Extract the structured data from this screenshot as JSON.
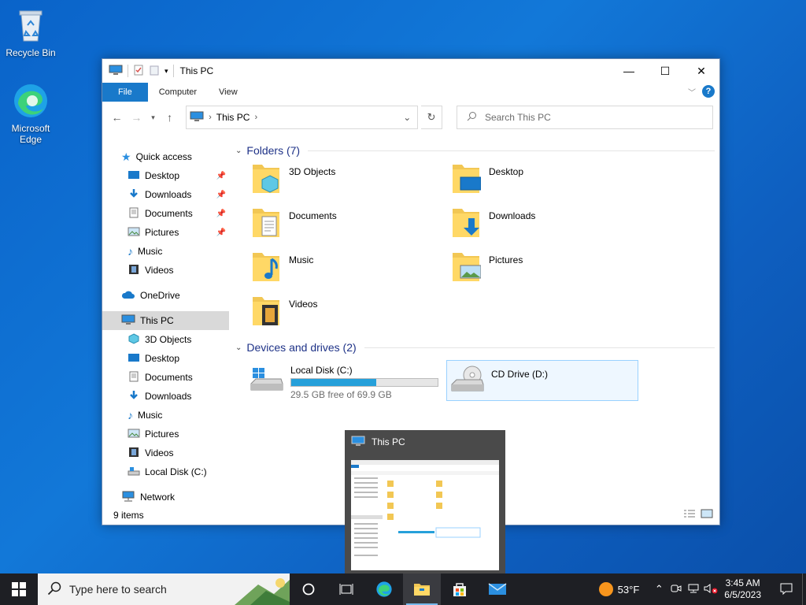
{
  "desktop": {
    "icons": [
      {
        "label": "Recycle Bin"
      },
      {
        "label": "Microsoft Edge"
      }
    ]
  },
  "window": {
    "title": "This PC",
    "controls": {
      "minimize": "—",
      "maximize": "☐",
      "close": "✕"
    },
    "ribbon": {
      "file": "File",
      "computer": "Computer",
      "view": "View"
    },
    "address": {
      "crumb": "This PC",
      "chev": "›"
    },
    "search": {
      "placeholder": "Search This PC"
    },
    "sidebar": {
      "quick_access": "Quick access",
      "quick_items": [
        "Desktop",
        "Downloads",
        "Documents",
        "Pictures",
        "Music",
        "Videos"
      ],
      "onedrive": "OneDrive",
      "this_pc": "This PC",
      "pc_items": [
        "3D Objects",
        "Desktop",
        "Documents",
        "Downloads",
        "Music",
        "Pictures",
        "Videos",
        "Local Disk (C:)"
      ],
      "network": "Network"
    },
    "folders_header": "Folders (7)",
    "folders": [
      "3D Objects",
      "Desktop",
      "Documents",
      "Downloads",
      "Music",
      "Pictures",
      "Videos"
    ],
    "devices_header": "Devices and drives (2)",
    "drives": [
      {
        "name": "Local Disk (C:)",
        "free": "29.5 GB free of 69.9 GB",
        "used_fraction": 0.578
      },
      {
        "name": "CD Drive (D:)"
      }
    ],
    "status": "9 items"
  },
  "preview": {
    "title": "This PC"
  },
  "taskbar": {
    "search_placeholder": "Type here to search",
    "weather": "53°F",
    "time": "3:45 AM",
    "date": "6/5/2023"
  },
  "colors": {
    "accent": "#1979ca",
    "selection": "#d9d9d9",
    "disk_fill": "#26a0da",
    "taskbar": "#1e1f24"
  }
}
